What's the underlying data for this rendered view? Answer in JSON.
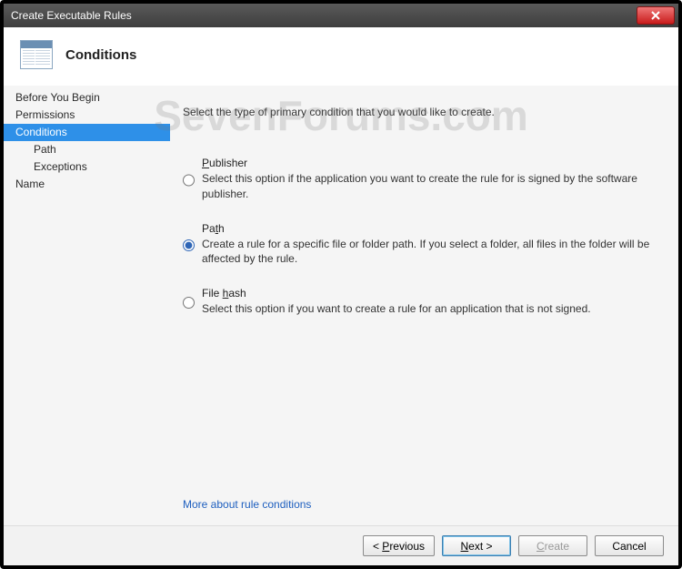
{
  "window": {
    "title": "Create Executable Rules"
  },
  "header": {
    "title": "Conditions"
  },
  "sidebar": {
    "items": [
      {
        "label": "Before You Begin",
        "selected": false,
        "sub": false
      },
      {
        "label": "Permissions",
        "selected": false,
        "sub": false
      },
      {
        "label": "Conditions",
        "selected": true,
        "sub": false
      },
      {
        "label": "Path",
        "selected": false,
        "sub": true
      },
      {
        "label": "Exceptions",
        "selected": false,
        "sub": true
      },
      {
        "label": "Name",
        "selected": false,
        "sub": false
      }
    ]
  },
  "main": {
    "intro": "Select the type of primary condition that you would like to create.",
    "options": [
      {
        "id": "publisher",
        "label": "Publisher",
        "u_index": 0,
        "desc": "Select this option if the application you want to create the rule for is signed by the software publisher.",
        "checked": false
      },
      {
        "id": "path",
        "label": "Path",
        "u_index": 2,
        "desc": "Create a rule for a specific file or folder path. If you select a folder, all files in the folder will be affected by the rule.",
        "checked": true
      },
      {
        "id": "filehash",
        "label": "File hash",
        "u_index": 5,
        "desc": "Select this option if you want to create a rule for an application that is not signed.",
        "checked": false
      }
    ],
    "help_link": "More about rule conditions"
  },
  "buttons": {
    "previous": "Previous",
    "next": "Next",
    "create": "Create",
    "cancel": "Cancel"
  },
  "watermark": "SevenForums.com"
}
